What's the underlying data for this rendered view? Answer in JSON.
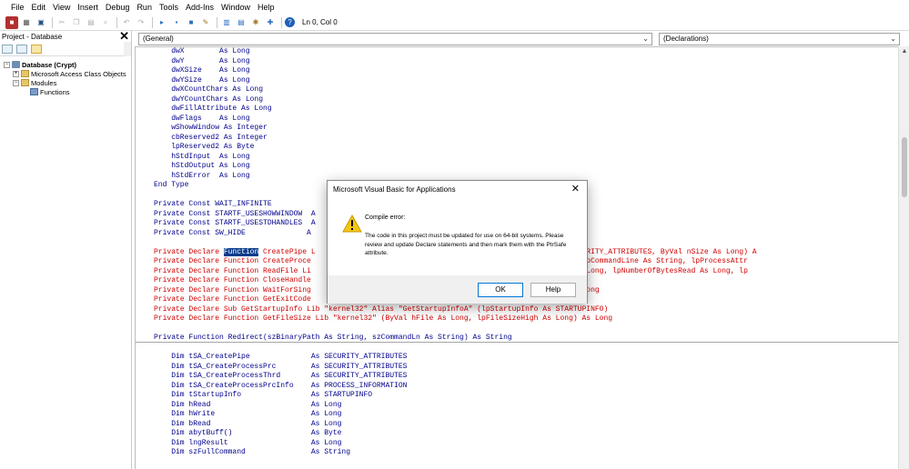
{
  "menu": [
    "File",
    "Edit",
    "View",
    "Insert",
    "Debug",
    "Run",
    "Tools",
    "Add-Ins",
    "Window",
    "Help"
  ],
  "toolbar": {
    "cursor_position": "Ln 0, Col 0",
    "icons": [
      "access-icon",
      "insert-module-icon",
      "save-icon",
      "cut-icon",
      "copy-icon",
      "paste-icon",
      "find-icon",
      "undo-icon",
      "redo-icon",
      "run-icon",
      "break-icon",
      "reset-icon",
      "design-mode-icon",
      "project-explorer-icon",
      "properties-icon",
      "object-browser-icon",
      "toolbox-icon",
      "help-icon"
    ]
  },
  "project_panel": {
    "title": "Project - Database",
    "close": "✕",
    "tree": [
      {
        "label": "Database (Crypt)",
        "level": 0,
        "expander": "−",
        "icon": "database-icon",
        "bold": true
      },
      {
        "label": "Microsoft Access Class Objects",
        "level": 1,
        "expander": "+",
        "icon": "folder-icon",
        "bold": false
      },
      {
        "label": "Modules",
        "level": 1,
        "expander": "−",
        "icon": "folder-icon",
        "bold": false
      },
      {
        "label": "Functions",
        "level": 2,
        "expander": "",
        "icon": "module-icon",
        "bold": false
      }
    ]
  },
  "code_window": {
    "object_dropdown": "(General)",
    "procedure_dropdown": "(Declarations)",
    "lines_top": [
      {
        "text": "    dwX        As Long",
        "kind": "kw"
      },
      {
        "text": "    dwY        As Long",
        "kind": "kw"
      },
      {
        "text": "    dwXSize    As Long",
        "kind": "kw"
      },
      {
        "text": "    dwYSize    As Long",
        "kind": "kw"
      },
      {
        "text": "    dwXCountChars As Long",
        "kind": "kw"
      },
      {
        "text": "    dwYCountChars As Long",
        "kind": "kw"
      },
      {
        "text": "    dwFillAttribute As Long",
        "kind": "kw"
      },
      {
        "text": "    dwFlags    As Long",
        "kind": "kw"
      },
      {
        "text": "    wShowWindow As Integer",
        "kind": "kw"
      },
      {
        "text": "    cbReserved2 As Integer",
        "kind": "kw"
      },
      {
        "text": "    lpReserved2 As Byte",
        "kind": "kw"
      },
      {
        "text": "    hStdInput  As Long",
        "kind": "kw"
      },
      {
        "text": "    hStdOutput As Long",
        "kind": "kw"
      },
      {
        "text": "    hStdError  As Long",
        "kind": "kw"
      },
      {
        "text": "End Type",
        "kind": "kw"
      },
      {
        "text": "",
        "kind": "kw"
      },
      {
        "text": "Private Const WAIT_INFINITE",
        "kind": "kw"
      },
      {
        "text": "Private Const STARTF_USESHOWWINDOW  A",
        "kind": "kw"
      },
      {
        "text": "Private Const STARTF_USESTDHANDLES  A",
        "kind": "kw"
      },
      {
        "text": "Private Const SW_HIDE              A",
        "kind": "kw"
      },
      {
        "text": "",
        "kind": "kw"
      },
      {
        "pre": "Private Declare ",
        "sel": "Function",
        "post": " CreatePipe L                                    , lpPipeAttributes As SECURITY_ATTRIBUTES, ByVal nSize As Long) A",
        "kind": "err"
      },
      {
        "text": "Private Declare Function CreateProce                                    cationName As Long, ByVal lpCommandLine As String, lpProcessAttr",
        "kind": "err"
      },
      {
        "text": "Private Declare Function ReadFile Li                                    al nNumberOfBytesToRead As Long, lpNumberOfBytesRead As Long, lp",
        "kind": "err"
      },
      {
        "text": "Private Declare Function CloseHandle",
        "kind": "err"
      },
      {
        "text": "Private Declare Function WaitForSing                                    wMilliseconds As Long) As Long",
        "kind": "err"
      },
      {
        "text": "Private Declare Function GetExitCode                                    ode As Long) As Long",
        "kind": "err"
      },
      {
        "text": "Private Declare Sub GetStartupInfo Lib \"kernel32\" Alias \"GetStartupInfoA\" (lpStartupInfo As STARTUPINFO)",
        "kind": "err"
      },
      {
        "text": "Private Declare Function GetFileSize Lib \"kernel32\" (ByVal hFile As Long, lpFileSizeHigh As Long) As Long",
        "kind": "err"
      }
    ],
    "lines_bottom": [
      {
        "text": "",
        "kind": "kw"
      },
      {
        "text": "Private Function Redirect(szBinaryPath As String, szCommandLn As String) As String",
        "kind": "kw"
      },
      {
        "text": "",
        "kind": "kw"
      },
      {
        "text": "    Dim tSA_CreatePipe              As SECURITY_ATTRIBUTES",
        "kind": "kw"
      },
      {
        "text": "    Dim tSA_CreateProcessPrc        As SECURITY_ATTRIBUTES",
        "kind": "kw"
      },
      {
        "text": "    Dim tSA_CreateProcessThrd       As SECURITY_ATTRIBUTES",
        "kind": "kw"
      },
      {
        "text": "    Dim tSA_CreateProcessPrcInfo    As PROCESS_INFORMATION",
        "kind": "kw"
      },
      {
        "text": "    Dim tStartupInfo                As STARTUPINFO",
        "kind": "kw"
      },
      {
        "text": "    Dim hRead                       As Long",
        "kind": "kw"
      },
      {
        "text": "    Dim hWrite                      As Long",
        "kind": "kw"
      },
      {
        "text": "    Dim bRead                       As Long",
        "kind": "kw"
      },
      {
        "text": "    Dim abytBuff()                  As Byte",
        "kind": "kw"
      },
      {
        "text": "    Dim lngResult                   As Long",
        "kind": "kw"
      },
      {
        "text": "    Dim szFullCommand               As String",
        "kind": "kw"
      }
    ]
  },
  "dialog": {
    "title": "Microsoft Visual Basic for Applications",
    "close": "✕",
    "error_title": "Compile error:",
    "message": "The code in this project must be updated for use on 64-bit systems. Please review and update Declare statements and then mark them with the PtrSafe attribute.",
    "ok_label": "OK",
    "help_label": "Help"
  },
  "colors": {
    "keyword_blue": "#00008b",
    "error_red": "#d00000",
    "selection": "#0a3d8c",
    "ok_border": "#0078d7"
  }
}
